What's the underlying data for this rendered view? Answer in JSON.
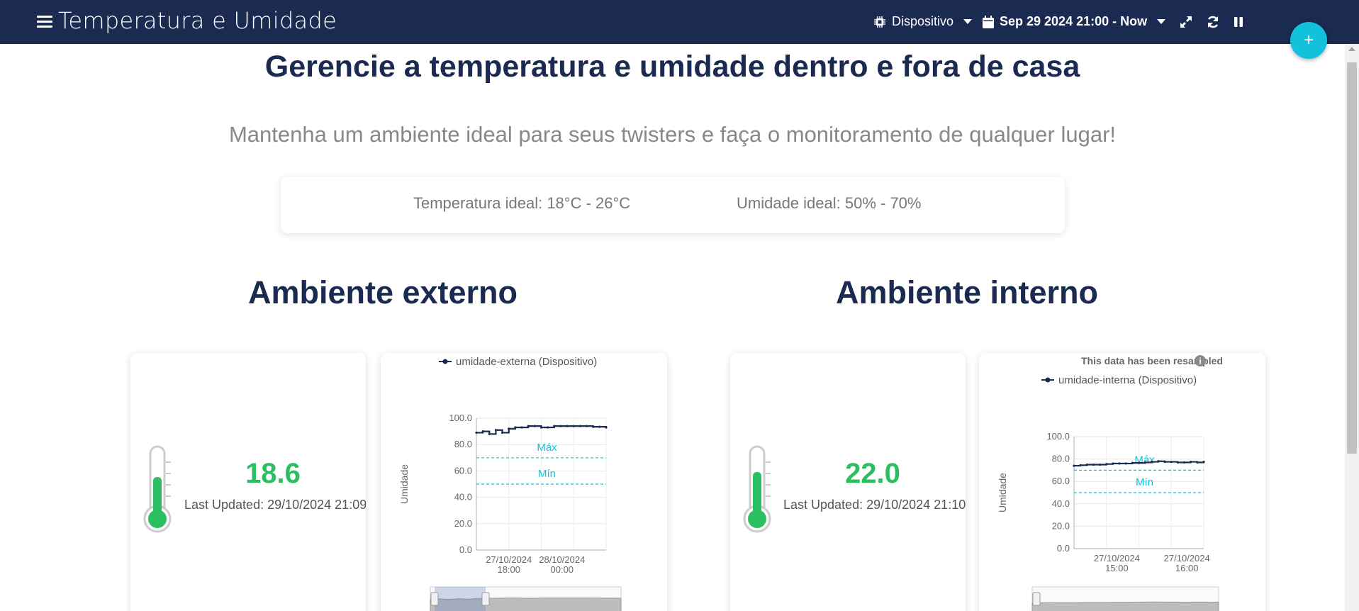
{
  "header": {
    "title": "Temperatura e Umidade",
    "device_label": "Dispositivo",
    "date_range": "Sep 29 2024 21:00 - Now"
  },
  "fab_label": "+",
  "main": {
    "heading": "Gerencie a temperatura e umidade dentro e fora de casa",
    "subheading": "Mantenha um ambiente ideal para seus twisters e faça o monitoramento de qualquer lugar!",
    "ideal_temp": "Temperatura ideal: 18°C - 26°C",
    "ideal_humidity": "Umidade ideal: 50% - 70%"
  },
  "external": {
    "title": "Ambiente externo",
    "value": "18.6",
    "last_updated": "Last Updated: 29/10/2024 21:09"
  },
  "internal": {
    "title": "Ambiente interno",
    "value": "22.0",
    "last_updated": "Last Updated: 29/10/2024 21:10"
  },
  "colors": {
    "navy": "#1b2a50",
    "accent": "#12c1dc",
    "reading_green": "#2cbf62"
  },
  "chart_data": [
    {
      "type": "line",
      "notice": "",
      "legend": "umidade-externa (Dispositivo)",
      "ylabel": "Umidade",
      "ylim": [
        0,
        100
      ],
      "yticks": [
        "0.0",
        "20.0",
        "40.0",
        "60.0",
        "80.0",
        "100.0"
      ],
      "xticks": [
        {
          "date": "27/10/2024",
          "time": "18:00"
        },
        {
          "date": "28/10/2024",
          "time": "00:00"
        }
      ],
      "thresholds": [
        {
          "label": "Máx",
          "value": 70
        },
        {
          "label": "Mín",
          "value": 50
        }
      ],
      "series": [
        {
          "name": "umidade-externa (Dispositivo)",
          "values": [
            89,
            90,
            88,
            91,
            89,
            92,
            93,
            93,
            94,
            94,
            93,
            93,
            94,
            94,
            94,
            94,
            94,
            94,
            93.5,
            93.5,
            93
          ]
        }
      ]
    },
    {
      "type": "line",
      "notice": "This data has been resampled",
      "legend": "umidade-interna (Dispositivo)",
      "ylabel": "Umidade",
      "ylim": [
        0,
        100
      ],
      "yticks": [
        "0.0",
        "20.0",
        "40.0",
        "60.0",
        "80.0",
        "100.0"
      ],
      "xticks": [
        {
          "date": "27/10/2024",
          "time": "15:00"
        },
        {
          "date": "27/10/2024",
          "time": "16:00"
        }
      ],
      "thresholds": [
        {
          "label": "Máx",
          "value": 70
        },
        {
          "label": "Mín",
          "value": 50
        }
      ],
      "series": [
        {
          "name": "umidade-interna (Dispositivo)",
          "values": [
            74,
            74.5,
            75,
            75,
            75,
            75.5,
            76,
            76,
            76,
            76.5,
            76.5,
            77,
            77.5,
            78,
            77.5,
            77.5,
            77,
            77,
            77.5,
            77,
            77.5
          ]
        }
      ]
    }
  ]
}
